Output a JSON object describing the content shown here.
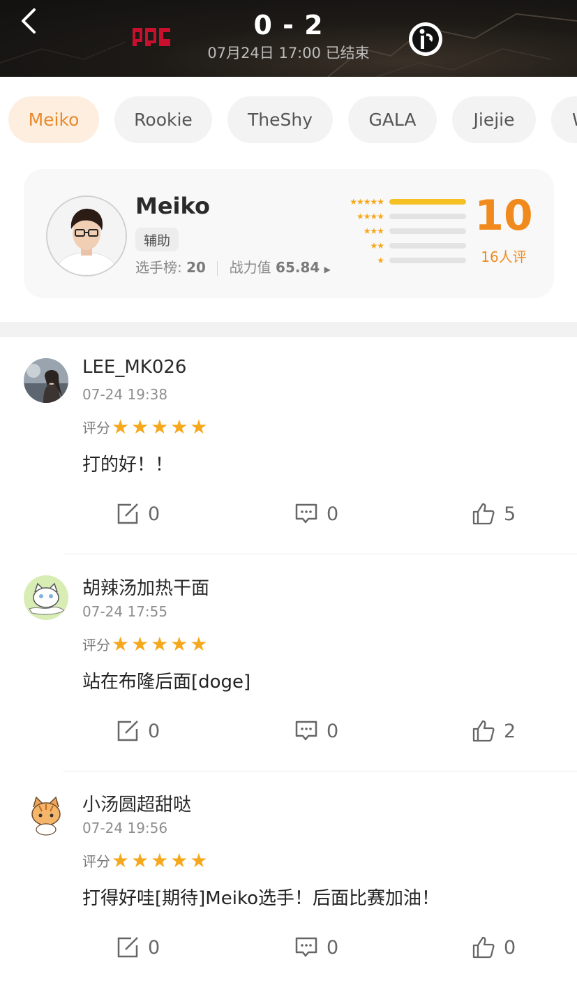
{
  "header": {
    "score": "0 - 2",
    "match_info": "07月24日 17:00 已结束",
    "team_left_logo": "jdg-logo",
    "team_right_logo": "ig-logo"
  },
  "tabs": [
    {
      "label": "Meiko",
      "active": true
    },
    {
      "label": "Rookie",
      "active": false
    },
    {
      "label": "TheShy",
      "active": false
    },
    {
      "label": "GALA",
      "active": false
    },
    {
      "label": "Jiejie",
      "active": false
    },
    {
      "label": "W",
      "active": false
    }
  ],
  "player": {
    "name": "Meiko",
    "role": "辅助",
    "rank_label": "选手榜: ",
    "rank_value": "20",
    "power_label": "战力值 ",
    "power_value": "65.84",
    "score": "10",
    "raters": "16人评",
    "rating_distribution": [
      {
        "stars": "★★★★★",
        "fraction": 1.0
      },
      {
        "stars": "★★★★",
        "fraction": 0.0
      },
      {
        "stars": "★★★",
        "fraction": 0.0
      },
      {
        "stars": "★★",
        "fraction": 0.0
      },
      {
        "stars": "★",
        "fraction": 0.0
      }
    ]
  },
  "comments": [
    {
      "user": "LEE_MK026",
      "time": "07-24 19:38",
      "rate_label": "评分",
      "stars": "★★★★★",
      "text": "打的好！！",
      "reposts": "0",
      "replies": "0",
      "likes": "5"
    },
    {
      "user": "胡辣汤加热干面",
      "time": "07-24 17:55",
      "rate_label": "评分",
      "stars": "★★★★★",
      "text": "站在布隆后面[doge]",
      "reposts": "0",
      "replies": "0",
      "likes": "2"
    },
    {
      "user": "小汤圆超甜哒",
      "time": "07-24 19:56",
      "rate_label": "评分",
      "stars": "★★★★★",
      "text": "打得好哇[期待]Meiko选手！后面比赛加油！",
      "reposts": "0",
      "replies": "0",
      "likes": "0"
    }
  ],
  "colors": {
    "accent": "#f08a1c",
    "star": "#f6a81c",
    "bar_fill": "#f5c024"
  }
}
